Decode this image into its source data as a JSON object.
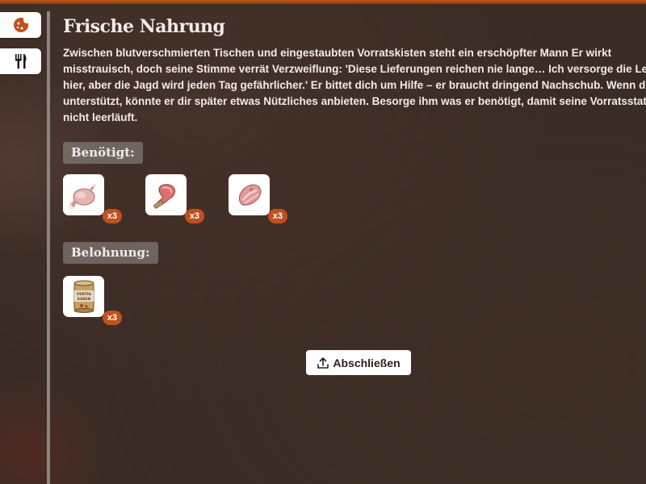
{
  "title": "Frische Nahrung",
  "description": "Zwischen blutverschmierten Tischen und eingestaubten Vorratskisten steht ein erschöpfter Mann Er wirkt misstrauisch, doch seine Stimme verrät Verzweiflung: 'Diese Lieferungen reichen nie lange… Ich versorge die Leute hier, aber die Jagd wird jeden Tag gefährlicher.' Er bittet dich um Hilfe – er braucht dringend Nachschub. Wenn du ihn unterstützt, könnte er dir später etwas Nützliches anbieten. Besorge ihm was er benötigt, damit seine Vorratsstation nicht leerläuft.",
  "tabs": [
    {
      "icon": "cookie-icon",
      "active": true
    },
    {
      "icon": "fork-knife-icon",
      "active": false
    }
  ],
  "required": {
    "label": "Benötigt:",
    "items": [
      {
        "icon": "raw-chicken-icon",
        "quantity": "x3"
      },
      {
        "icon": "meat-bone-icon",
        "quantity": "x3"
      },
      {
        "icon": "raw-meat-icon",
        "quantity": "x3"
      }
    ]
  },
  "reward": {
    "label": "Belohnung:",
    "items": [
      {
        "icon": "canned-food-icon",
        "can_text": "FERTIG ESSEN",
        "quantity": "x3"
      }
    ]
  },
  "complete_button": {
    "label": "Abschließen",
    "icon": "upload-icon"
  },
  "colors": {
    "accent": "#c0511f",
    "background": "#3a2c25",
    "text": "#f1ebe7"
  }
}
